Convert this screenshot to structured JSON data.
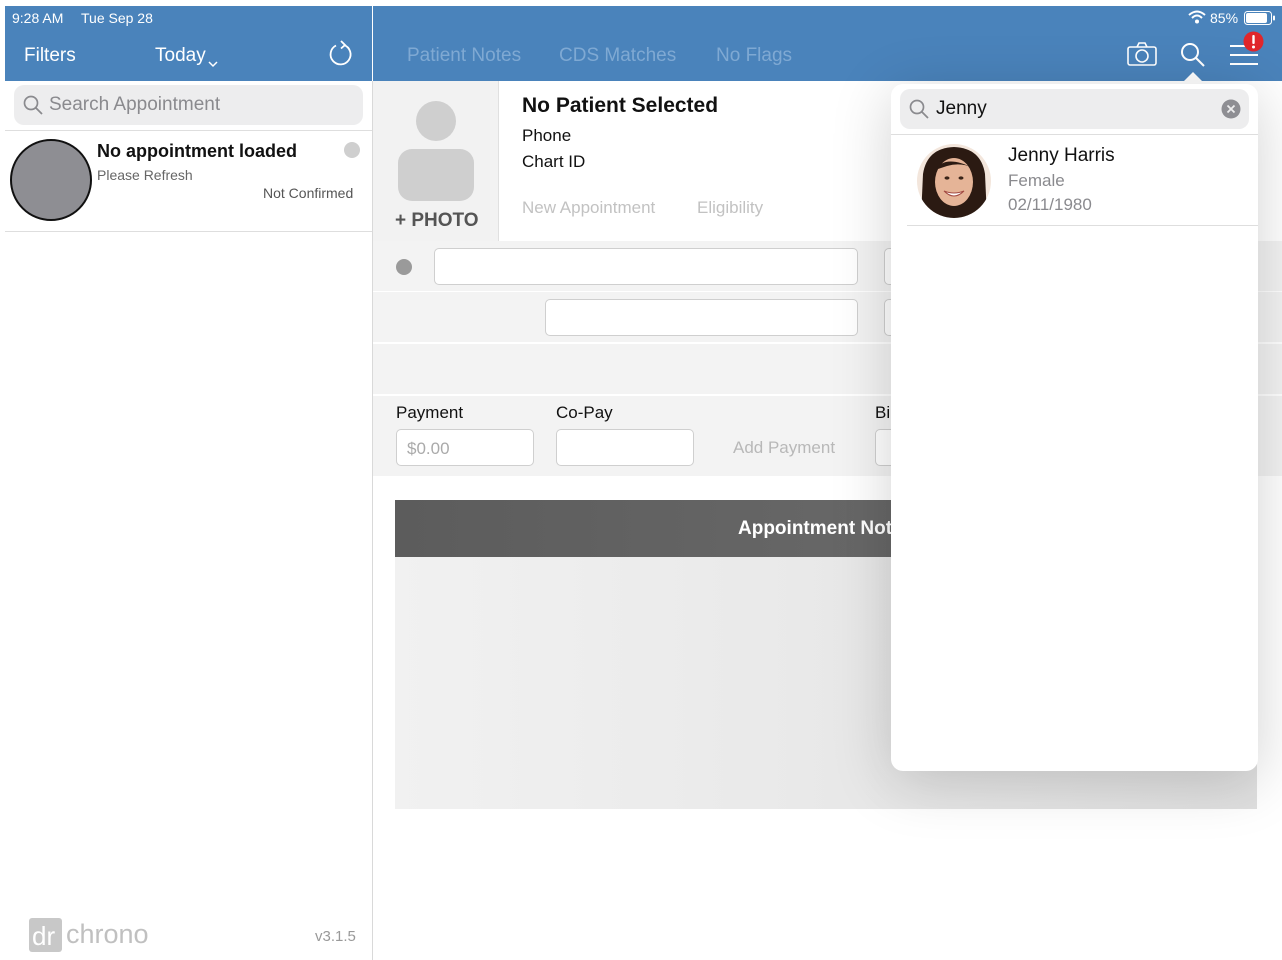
{
  "status_bar": {
    "time": "9:28 AM",
    "date": "Tue Sep 28",
    "battery": "85%"
  },
  "sidebar": {
    "filters_label": "Filters",
    "date_filter": "Today",
    "search_placeholder": "Search Appointment",
    "appointment": {
      "title": "No appointment loaded",
      "subtitle": "Please Refresh",
      "status": "Not Confirmed"
    },
    "logo": {
      "dr": "dr",
      "chrono": "chrono"
    },
    "version": "v3.1.5"
  },
  "header": {
    "tabs": [
      "Patient Notes",
      "CDS Matches",
      "No Flags"
    ]
  },
  "patient": {
    "photo_label": "PHOTO",
    "name": "No Patient Selected",
    "phone_label": "Phone",
    "chart_label": "Chart ID",
    "actions": [
      "New Appointment",
      "Eligibility"
    ]
  },
  "payment": {
    "payment_label": "Payment",
    "payment_value": "$0.00",
    "copay_label": "Co-Pay",
    "add_payment": "Add Payment",
    "billing_label": "Bi"
  },
  "notes": {
    "title": "Appointment Not"
  },
  "patient_search": {
    "query": "Jenny",
    "results": [
      {
        "name": "Jenny Harris",
        "gender": "Female",
        "dob": "02/11/1980"
      }
    ]
  },
  "colors": {
    "header_blue": "#4a83bb",
    "tab_inactive": "#7fa9d3",
    "alert_red": "#e0262b"
  }
}
